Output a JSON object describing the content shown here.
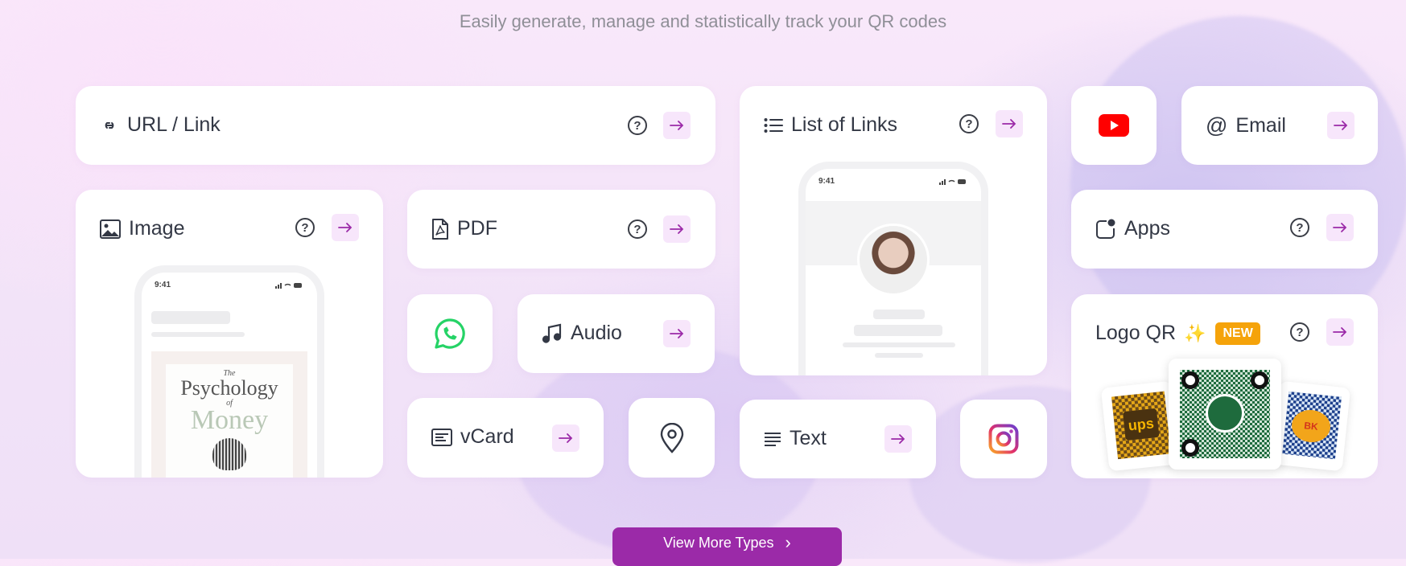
{
  "header": {
    "tagline": "Easily generate, manage and statistically track your QR codes"
  },
  "cards": {
    "url": {
      "label": "URL / Link",
      "icon": "link-icon"
    },
    "list_of_links": {
      "label": "List of Links",
      "icon": "list-icon",
      "preview_time": "9:41"
    },
    "youtube": {
      "icon": "youtube-icon",
      "color": "#ff0000"
    },
    "email": {
      "label": "Email",
      "icon_glyph": "@"
    },
    "image": {
      "label": "Image",
      "icon": "image-icon",
      "preview_time": "9:41",
      "book_line1": "The",
      "book_line2": "Psychology",
      "book_line3": "of",
      "book_line4": "Money"
    },
    "pdf": {
      "label": "PDF",
      "icon": "pdf-icon"
    },
    "apps": {
      "label": "Apps",
      "icon": "apps-icon"
    },
    "whatsapp": {
      "icon": "whatsapp-icon",
      "color": "#25d366"
    },
    "audio": {
      "label": "Audio",
      "icon": "music-note-icon"
    },
    "logo_qr": {
      "label": "Logo QR",
      "sparkle": "✨",
      "badge": "NEW",
      "badge_color": "#f5a30a",
      "samples": [
        "ups",
        "starbucks",
        "burger king"
      ]
    },
    "vcard": {
      "label": "vCard",
      "icon": "vcard-icon"
    },
    "location": {
      "icon": "location-pin-icon"
    },
    "text": {
      "label": "Text",
      "icon": "text-lines-icon"
    },
    "instagram": {
      "icon": "instagram-icon"
    }
  },
  "help_glyph": "?",
  "cta": {
    "label": "View More Types",
    "chevron": "›",
    "color": "#9b2aa8"
  }
}
